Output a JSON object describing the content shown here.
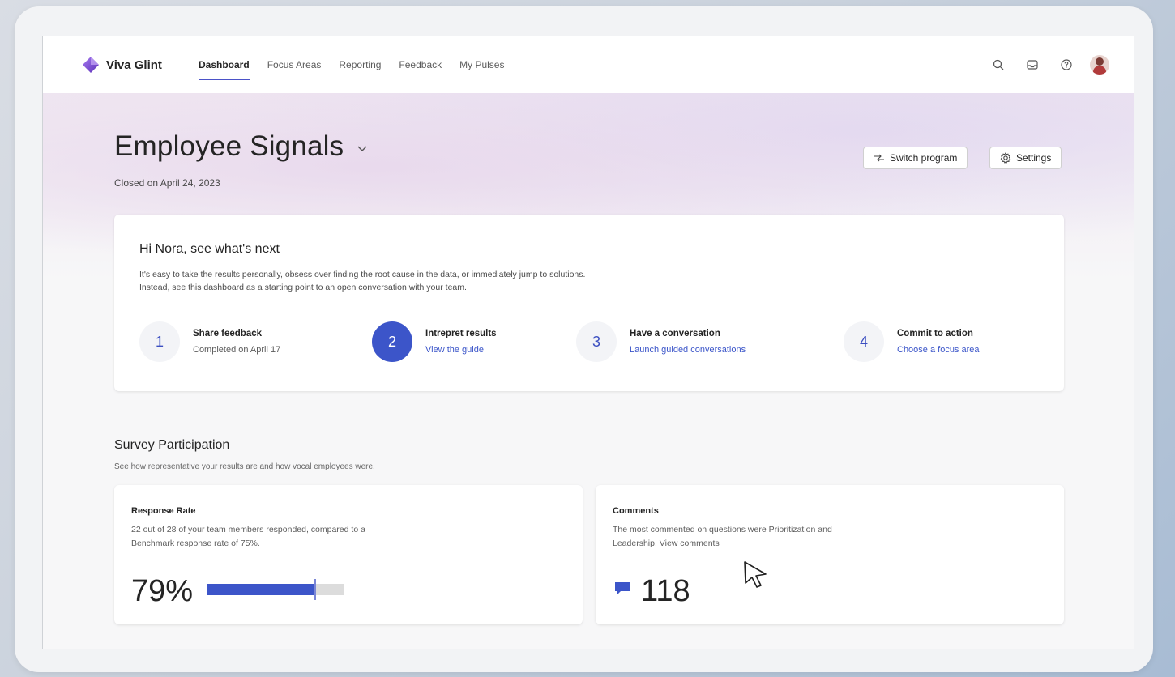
{
  "app": {
    "name": "Viva Glint",
    "brand_color": "#7b49d6",
    "accent_color": "#3c55c9"
  },
  "nav": {
    "items": [
      {
        "label": "Dashboard",
        "active": true
      },
      {
        "label": "Focus Areas",
        "active": false
      },
      {
        "label": "Reporting",
        "active": false
      },
      {
        "label": "Feedback",
        "active": false
      },
      {
        "label": "My Pulses",
        "active": false
      }
    ]
  },
  "top_icons": [
    "search-icon",
    "inbox-icon",
    "help-icon",
    "avatar"
  ],
  "header": {
    "title": "Employee Signals",
    "closed_text": "Closed on April 24, 2023",
    "switch_program_label": "Switch program",
    "settings_label": "Settings"
  },
  "next": {
    "title": "Hi Nora, see what's next",
    "desc_line1": "It's easy to take the results personally, obsess over finding the root cause in the data, or immediately jump to solutions.",
    "desc_line2": "Instead, see this dashboard as a starting point to an open conversation with your team.",
    "steps": [
      {
        "number": "1",
        "name": "Share feedback",
        "sub": "Completed on April 17",
        "active": false
      },
      {
        "number": "2",
        "name": "Intrepret results",
        "sub": "View the guide",
        "active": true
      },
      {
        "number": "3",
        "name": "Have a conversation",
        "sub": "Launch guided conversations",
        "active": false
      },
      {
        "number": "4",
        "name": "Commit to action",
        "sub": "Choose a focus area",
        "active": false
      }
    ]
  },
  "participation": {
    "title": "Survey Participation",
    "subtitle": "See how representative your results are and how vocal employees were.",
    "response_rate": {
      "label": "Response Rate",
      "desc_line1": "22 out of 28 of your team members responded, compared to a",
      "desc_line2": "Benchmark response rate of 75%.",
      "value": "79%",
      "fill_fraction": 0.79,
      "benchmark_fraction": 0.75
    },
    "comments": {
      "label": "Comments",
      "desc_line1": "The most commented on questions were Prioritization and",
      "desc_line2": "Leadership. View comments",
      "value": "118"
    }
  }
}
